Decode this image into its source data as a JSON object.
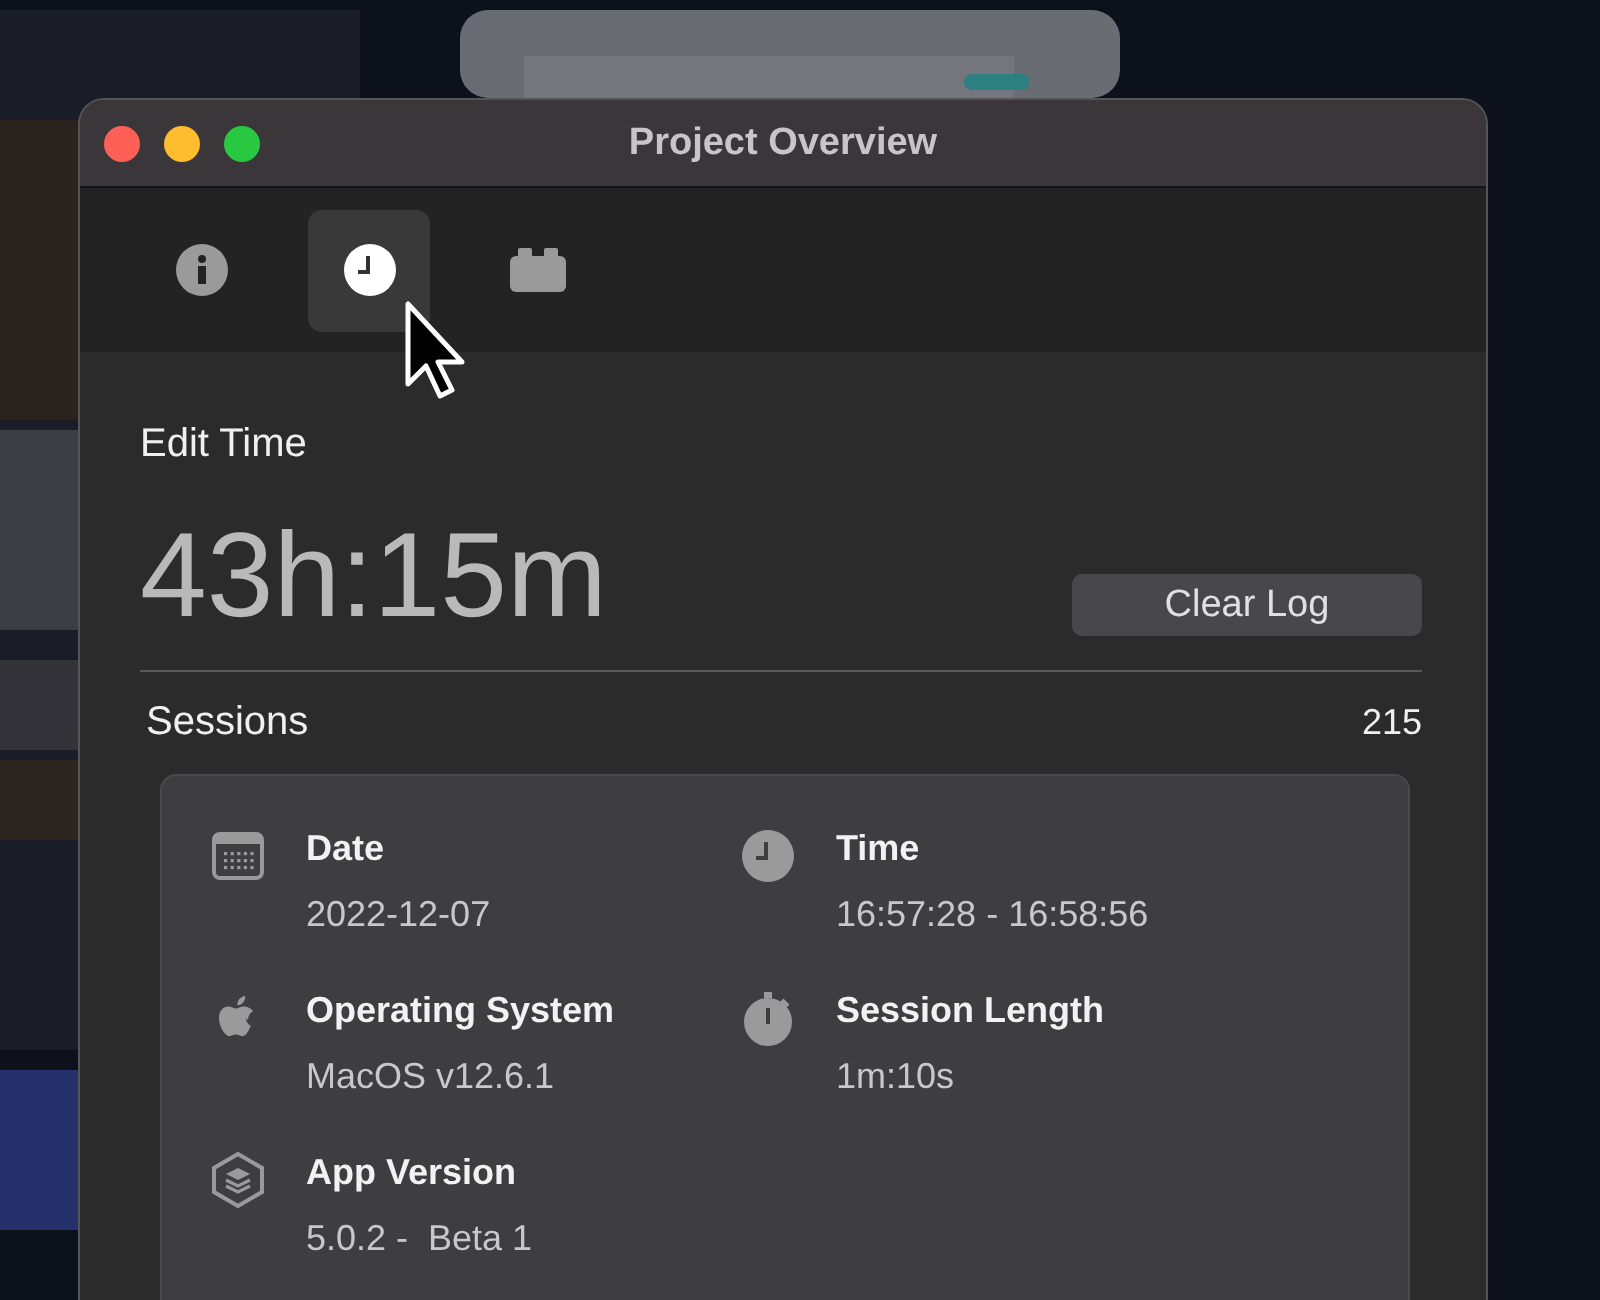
{
  "window": {
    "title": "Project Overview"
  },
  "tabs": [
    {
      "kind": "info",
      "selected": false
    },
    {
      "kind": "clock",
      "selected": true
    },
    {
      "kind": "brick",
      "selected": false
    }
  ],
  "edit_time": {
    "label": "Edit Time",
    "value": "43h:15m",
    "button": "Clear Log"
  },
  "sessions": {
    "label": "Sessions",
    "count": "215",
    "fields": [
      {
        "kind": "calendar",
        "label": "Date",
        "value": "2022-12-07"
      },
      {
        "kind": "clock",
        "label": "Time",
        "value": "16:57:28 - 16:58:56"
      },
      {
        "kind": "apple",
        "label": "Operating System",
        "value": "MacOS v12.6.1"
      },
      {
        "kind": "stopwatch",
        "label": "Session Length",
        "value": "1m:10s"
      },
      {
        "kind": "layers",
        "label": "App Version",
        "value": "5.0.2 -  Beta 1"
      }
    ]
  }
}
